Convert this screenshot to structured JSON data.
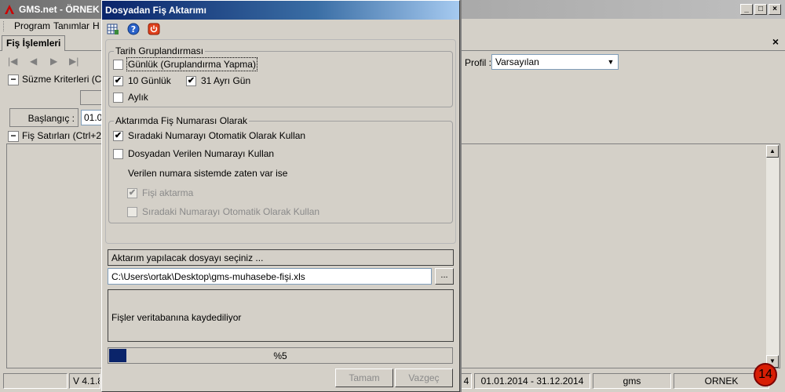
{
  "main": {
    "title": "GMS.net - ÖRNEK - ...",
    "menu": [
      "Program",
      "Tanımlar",
      "H"
    ],
    "tab": "Fiş İşlemleri",
    "tab_close": "×",
    "profil_label": "Profil :",
    "profil_value": "Varsayılan",
    "filter_section": "Süzme Kriterleri (C",
    "baslangic_label": "Başlangıç :",
    "baslangic_value": "01.0",
    "lines_section": "Fiş Satırları (Ctrl+2",
    "status": {
      "version": "V 4.1.8",
      "p2": "4",
      "period": "01.01.2014 - 31.12.2014",
      "user": "gms",
      "company": "ORNEK"
    },
    "badge": "14"
  },
  "dialog": {
    "title": "Dosyadan Fiş Aktarımı",
    "toolbar_icons": [
      "grid-icon",
      "help-icon",
      "power-icon"
    ],
    "group1": {
      "title": "Tarih Gruplandırması",
      "options": [
        {
          "label": "Günlük (Gruplandırma Yapma)",
          "checked": false
        },
        {
          "label": "10 Günlük",
          "checked": true
        },
        {
          "label": "31 Ayrı Gün",
          "checked": true
        },
        {
          "label": "Aylık",
          "checked": false
        }
      ]
    },
    "group2": {
      "title": "Aktarımda Fiş Numarası Olarak",
      "opt1": {
        "label": "Sıradaki Numarayı Otomatik Olarak Kullan",
        "checked": true
      },
      "opt2": {
        "label": "Dosyadan Verilen Numarayı Kullan",
        "checked": false
      },
      "note": "Verilen numara sistemde zaten var ise",
      "sub1": {
        "label": "Fişi aktarma",
        "checked": true,
        "disabled": true
      },
      "sub2": {
        "label": "Sıradaki Numarayı Otomatik Olarak Kullan",
        "checked": false,
        "disabled": true
      }
    },
    "file_prompt": "Aktarım yapılacak dosyayı seçiniz ...",
    "file_path": "C:\\Users\\ortak\\Desktop\\gms-muhasebe-fişi.xls",
    "browse": "...",
    "status_text": "Fişler veritabanına kaydediliyor",
    "progress_percent": 5,
    "progress_label": "%5",
    "ok_button": "Tamam",
    "cancel_button": "Vazgeç",
    "checkmark": "✔"
  }
}
